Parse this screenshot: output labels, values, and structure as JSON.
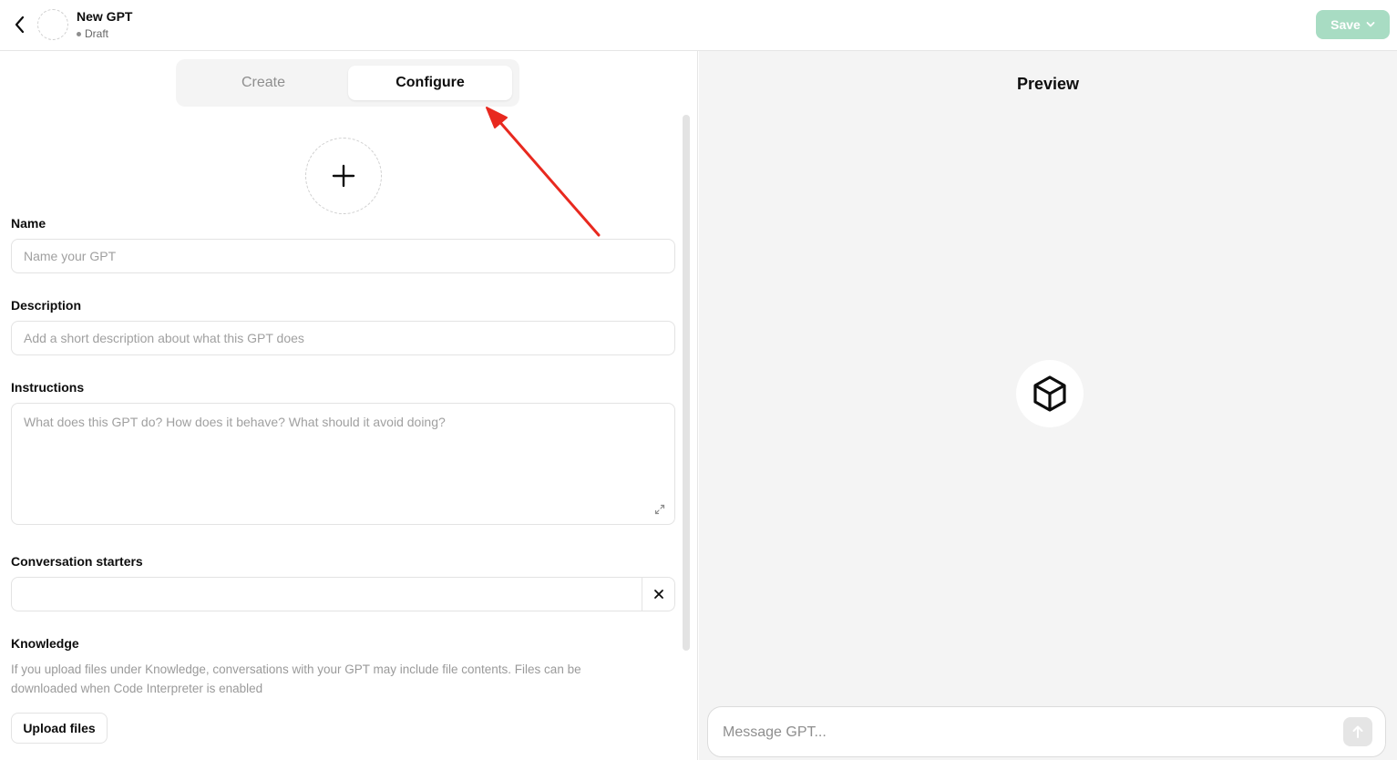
{
  "header": {
    "back_icon": "chevron-left-icon",
    "title": "New GPT",
    "status": "Draft",
    "save_label": "Save",
    "save_color": "#a8dcc3"
  },
  "tabs": [
    {
      "label": "Create",
      "active": false
    },
    {
      "label": "Configure",
      "active": true
    }
  ],
  "form": {
    "name_label": "Name",
    "name_placeholder": "Name your GPT",
    "name_value": "",
    "description_label": "Description",
    "description_placeholder": "Add a short description about what this GPT does",
    "description_value": "",
    "instructions_label": "Instructions",
    "instructions_placeholder": "What does this GPT do? How does it behave? What should it avoid doing?",
    "instructions_value": "",
    "starters_label": "Conversation starters",
    "starter_value": "",
    "knowledge_label": "Knowledge",
    "knowledge_description": "If you upload files under Knowledge, conversations with your GPT may include file contents. Files can be downloaded when Code Interpreter is enabled",
    "upload_label": "Upload files"
  },
  "preview": {
    "title": "Preview",
    "icon": "cube-icon",
    "message_placeholder": "Message GPT..."
  },
  "annotation": {
    "color": "#e8291f",
    "icon": "red-arrow-annotation"
  }
}
